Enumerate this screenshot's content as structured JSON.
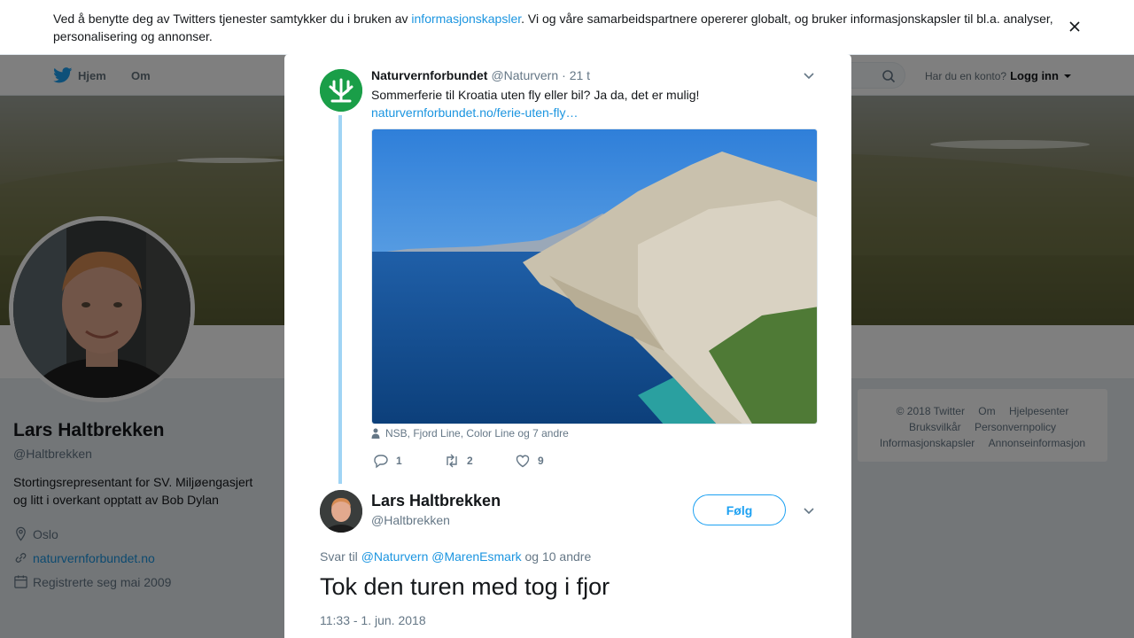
{
  "cookie": {
    "text_before": "Ved å benytte deg av Twitters tjenester samtykker du i bruken av ",
    "link": "informasjonskapsler",
    "text_after": ". Vi og våre samarbeidspartnere opererer globalt, og bruker informasjonskapsler til bl.a. analyser, personalisering og annonser."
  },
  "nav": {
    "home": "Hjem",
    "about": "Om",
    "login_prompt": "Har du en konto?",
    "login_label": "Logg inn"
  },
  "profile": {
    "name": "Lars Haltbrekken",
    "handle": "@Haltbrekken",
    "bio": "Stortingsrepresentant for SV. Miljøengasjert og litt i overkant opptatt av Bob Dylan",
    "location": "Oslo",
    "website": "naturvernforbundet.no",
    "joined": "Registrerte seg mai 2009"
  },
  "footer": {
    "copyright": "© 2018 Twitter",
    "links": [
      "Om",
      "Hjelpesenter",
      "Bruksvilkår",
      "Personvernpolicy",
      "Informasjonskapsler",
      "Annonseinformasjon"
    ]
  },
  "parent_tweet": {
    "name": "Naturvernforbundet",
    "handle": "@Naturvern",
    "time": "· 21 t",
    "text": "Sommerferie til Kroatia uten fly eller bil? Ja da, det er mulig!",
    "link": "naturvernforbundet.no/ferie-uten-fly…",
    "tags": "NSB, Fjord Line, Color Line og 7 andre",
    "replies": "1",
    "retweets": "2",
    "likes": "9"
  },
  "main_tweet": {
    "name": "Lars Haltbrekken",
    "handle": "@Haltbrekken",
    "follow_label": "Følg",
    "reply_prefix": "Svar til",
    "reply_mentions": "@Naturvern @MarenEsmark",
    "reply_suffix": "og 10 andre",
    "text": "Tok den turen med tog i fjor",
    "timestamp": "11:33 - 1. jun. 2018"
  },
  "colors": {
    "accent": "#1da1f2",
    "link": "#1b95e0",
    "brand_green": "#1a9e48"
  }
}
